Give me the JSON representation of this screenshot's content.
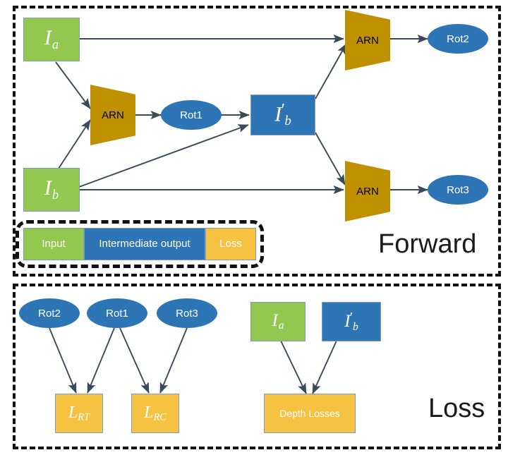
{
  "diagram": {
    "panels": [
      {
        "id": "forward",
        "title": "Forward"
      },
      {
        "id": "loss",
        "title": "Loss"
      }
    ],
    "legend": {
      "input_label": "Input",
      "intermediate_label": "Intermediate output",
      "loss_label": "Loss"
    },
    "forward": {
      "image_a": "I",
      "image_a_sub": "a",
      "image_b": "I",
      "image_b_sub": "b",
      "image_b_prime": "I",
      "image_b_prime_sub": "b",
      "image_b_prime_mark": "′",
      "arn_mid": "ARN",
      "arn_top": "ARN",
      "arn_bottom": "ARN",
      "rot1": "Rot1",
      "rot2": "Rot2",
      "rot3": "Rot3"
    },
    "loss": {
      "rot2": "Rot2",
      "rot1": "Rot1",
      "rot3": "Rot3",
      "l_rt": "L",
      "l_rt_sub": "RT",
      "l_rc": "L",
      "l_rc_sub": "RC",
      "image_a": "I",
      "image_a_sub": "a",
      "image_b_prime": "I",
      "image_b_prime_sub": "b",
      "image_b_prime_mark": "′",
      "depth_losses": "Depth Losses"
    },
    "colors": {
      "input_green": "#92c84f",
      "intermediate_blue": "#2e75b6",
      "loss_yellow": "#f5c242",
      "network_gold": "#bf9000",
      "edge": "#3b4a5a",
      "panel_border": "#111111"
    }
  }
}
